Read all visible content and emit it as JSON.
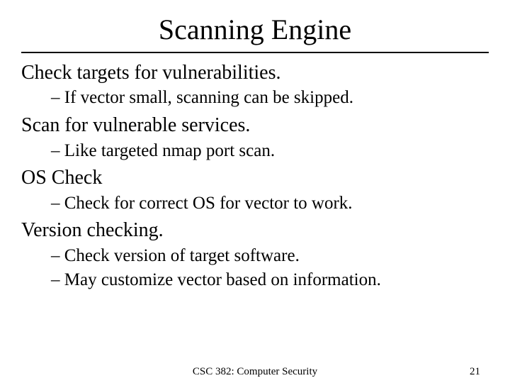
{
  "title": "Scanning Engine",
  "sections": [
    {
      "main": "Check targets for vulnerabilities.",
      "subs": [
        "– If vector small, scanning can be skipped."
      ]
    },
    {
      "main": "Scan for vulnerable services.",
      "subs": [
        "– Like targeted nmap port scan."
      ]
    },
    {
      "main": "OS Check",
      "subs": [
        "– Check for correct OS for vector to work."
      ]
    },
    {
      "main": "Version checking.",
      "subs": [
        "– Check version of target software.",
        "– May customize vector based on information."
      ]
    }
  ],
  "footer": {
    "course": "CSC 382: Computer Security",
    "page": "21"
  }
}
